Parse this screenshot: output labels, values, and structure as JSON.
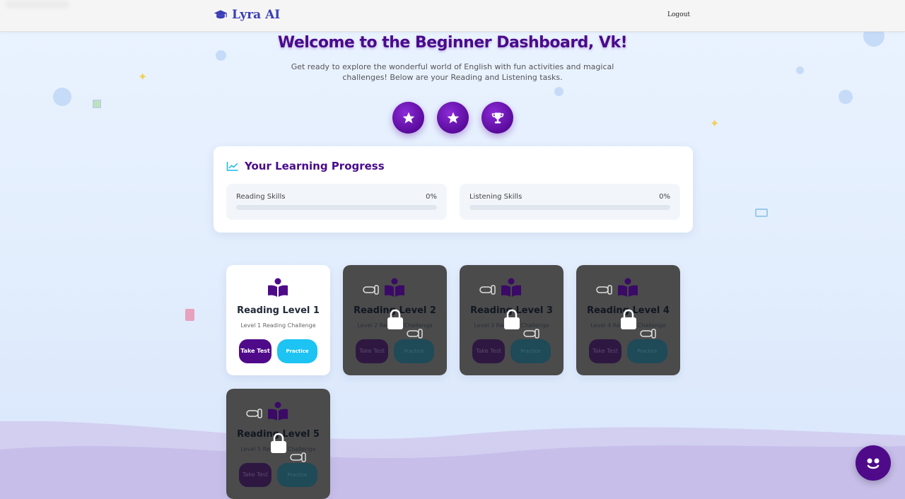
{
  "nav": {
    "brand": "Lyra AI",
    "logout": "Logout"
  },
  "hero": {
    "title": "Welcome to the Beginner Dashboard, Vk!",
    "subtitle": "Get ready to explore the wonderful world of English with fun activities and magical challenges! Below are your Reading and Listening tasks.",
    "badges": [
      "star-icon",
      "star-icon",
      "trophy-icon"
    ]
  },
  "progress": {
    "title": "Your Learning Progress",
    "skills": [
      {
        "label": "Reading Skills",
        "percent": "0%",
        "value": 0
      },
      {
        "label": "Listening Skills",
        "percent": "0%",
        "value": 0
      }
    ]
  },
  "levels": [
    {
      "name": "Reading Level 1",
      "desc": "Level 1 Reading Challenge",
      "test": "Take Test",
      "practice": "Practice",
      "locked": false
    },
    {
      "name": "Reading Level 2",
      "desc": "Level 2 Reading Challenge",
      "test": "Take Test",
      "practice": "Practice",
      "locked": true
    },
    {
      "name": "Reading Level 3",
      "desc": "Level 3 Reading Challenge",
      "test": "Take Test",
      "practice": "Practice",
      "locked": true
    },
    {
      "name": "Reading Level 4",
      "desc": "Level 4 Reading Challenge",
      "test": "Take Test",
      "practice": "Practice",
      "locked": true
    },
    {
      "name": "Reading Level 5",
      "desc": "Level 5 Reading Challenge",
      "test": "Take Test",
      "practice": "Practice",
      "locked": true
    }
  ],
  "colors": {
    "accent_purple": "#4f0a8a",
    "accent_cyan": "#1cc3f3",
    "title_purple": "#4a0a8c"
  }
}
